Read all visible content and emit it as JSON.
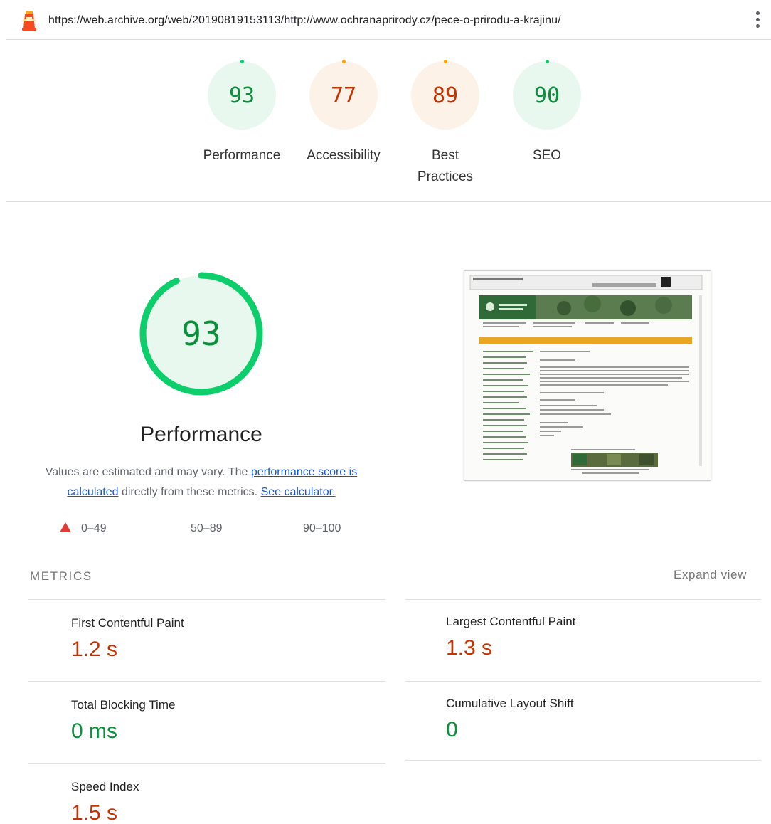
{
  "urlbar": {
    "url": "https://web.archive.org/web/20190819153113/http://www.ochranaprirody.cz/pece-o-prirodu-a-krajinu/"
  },
  "categories": [
    {
      "score": "93",
      "label": "Performance",
      "rating": "good"
    },
    {
      "score": "77",
      "label": "Accessibility",
      "rating": "average"
    },
    {
      "score": "89",
      "label": "Best Practices",
      "rating": "average"
    },
    {
      "score": "90",
      "label": "SEO",
      "rating": "good"
    }
  ],
  "performance": {
    "score": "93",
    "score_fraction": 0.93,
    "title": "Performance",
    "desc_prefix": "Values are estimated and may vary. The ",
    "desc_link1": "performance score is calculated",
    "desc_mid": " directly from these metrics. ",
    "desc_link2": "See calculator."
  },
  "legend": {
    "fail": "0–49",
    "average": "50–89",
    "pass": "90–100"
  },
  "metrics": {
    "heading": "METRICS",
    "expand_label": "Expand view",
    "items": [
      {
        "label": "First Contentful Paint",
        "value": "1.2 s",
        "rating": "average"
      },
      {
        "label": "Largest Contentful Paint",
        "value": "1.3 s",
        "rating": "average"
      },
      {
        "label": "Total Blocking Time",
        "value": "0 ms",
        "rating": "good"
      },
      {
        "label": "Cumulative Layout Shift",
        "value": "0",
        "rating": "good"
      },
      {
        "label": "Speed Index",
        "value": "1.5 s",
        "rating": "average"
      }
    ]
  },
  "colors": {
    "good": "#0cce6b",
    "average": "#ffa400",
    "fail": "#ff4e42",
    "link": "#1a55d1"
  },
  "icons": {
    "logo": "lighthouse-icon",
    "menu": "more-vert-icon",
    "fail_marker": "red-triangle-icon"
  }
}
